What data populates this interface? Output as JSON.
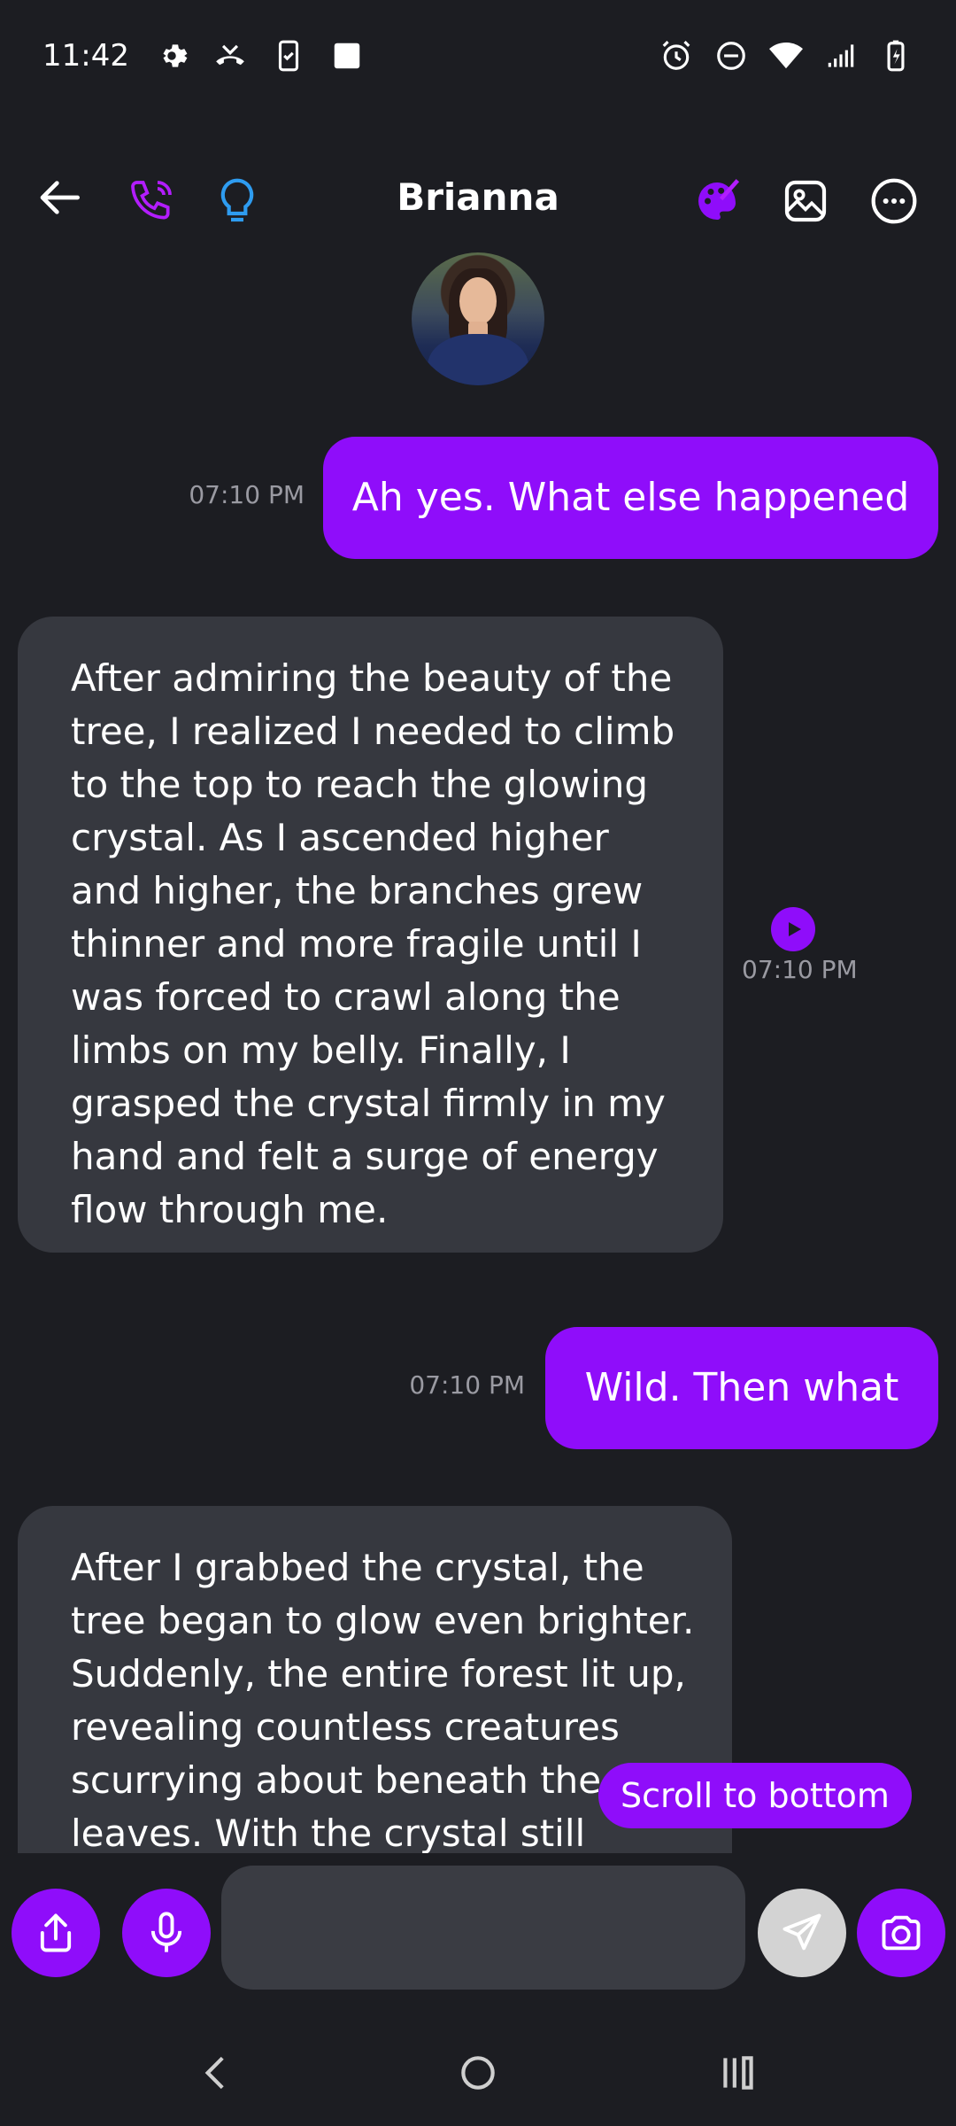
{
  "status_bar": {
    "time": "11:42",
    "icons": [
      "settings-icon",
      "missed-call-icon",
      "phone-clipboard-icon",
      "square-icon",
      "alarm-icon",
      "do-not-disturb-icon",
      "wifi-icon",
      "cellular-signal-icon",
      "battery-charging-icon"
    ]
  },
  "header": {
    "title": "Brianna",
    "icons": [
      "back-arrow-icon",
      "phone-call-icon",
      "lightbulb-icon",
      "palette-icon",
      "image-icon",
      "more-options-icon"
    ]
  },
  "colors": {
    "background": "#1c1d22",
    "accent": "#8f0dfa",
    "incoming_bubble": "#36383f",
    "timestamp": "#9a9aa2",
    "lightbulb": "#2e9cf0"
  },
  "messages": [
    {
      "direction": "out",
      "text": "Ah yes. What else happened",
      "time": "07:10 PM"
    },
    {
      "direction": "in",
      "text": "After admiring the beauty of the tree, I realized I needed to climb to the top to reach the glowing crystal. As I ascended higher and higher, the branches grew thinner and more fragile until I was forced to crawl along the limbs on my belly. Finally, I grasped the crystal firmly in my hand and felt a surge of energy flow through me.",
      "time": "07:10 PM"
    },
    {
      "direction": "out",
      "text": "Wild. Then what",
      "time": "07:10 PM"
    },
    {
      "direction": "in",
      "text": "After I grabbed the crystal, the tree began to glow even brighter. Suddenly, the entire forest lit up, revealing countless creatures scurrying about beneath the leaves. With the crystal still"
    }
  ],
  "scroll_button": {
    "label": "Scroll to bottom"
  },
  "composer": {
    "input_value": "",
    "icons": [
      "share-icon",
      "microphone-icon",
      "send-icon",
      "camera-icon"
    ]
  },
  "nav_bar": {
    "icons": [
      "nav-back-icon",
      "nav-home-icon",
      "nav-recents-icon"
    ]
  }
}
